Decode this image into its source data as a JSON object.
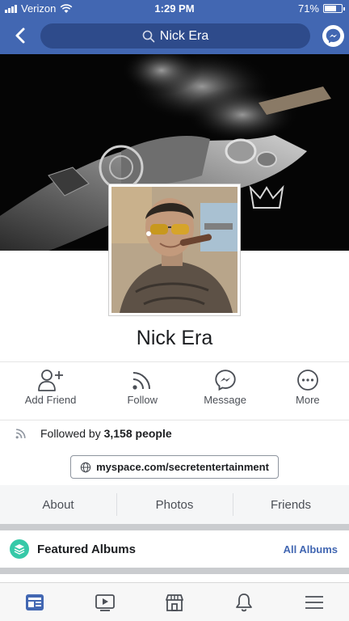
{
  "status_bar": {
    "carrier": "Verizon",
    "time": "1:29 PM",
    "battery": "71%",
    "battery_level": 0.71
  },
  "nav": {
    "search_value": "Nick Era",
    "back_icon": "chevron-left-icon",
    "messenger_icon": "messenger-icon"
  },
  "profile": {
    "name": "Nick Era"
  },
  "actions": [
    {
      "label": "Add Friend",
      "icon": "add-friend-icon"
    },
    {
      "label": "Follow",
      "icon": "rss-icon"
    },
    {
      "label": "Message",
      "icon": "messenger-icon"
    },
    {
      "label": "More",
      "icon": "more-icon"
    }
  ],
  "followers": {
    "prefix": "Followed by",
    "count": "3,158 people"
  },
  "website": {
    "url": "myspace.com/secretentertainment"
  },
  "tabs": [
    {
      "label": "About"
    },
    {
      "label": "Photos"
    },
    {
      "label": "Friends"
    }
  ],
  "featured": {
    "title": "Featured Albums",
    "link": "All Albums"
  },
  "tabbar": [
    {
      "icon": "news-feed-icon",
      "active": true
    },
    {
      "icon": "watch-icon",
      "active": false
    },
    {
      "icon": "marketplace-icon",
      "active": false
    },
    {
      "icon": "notifications-icon",
      "active": false
    },
    {
      "icon": "menu-icon",
      "active": false
    }
  ],
  "colors": {
    "brand": "#4267b2",
    "text": "#1c1e21",
    "muted": "#4b4f56",
    "accent_teal": "#36c9a8"
  }
}
